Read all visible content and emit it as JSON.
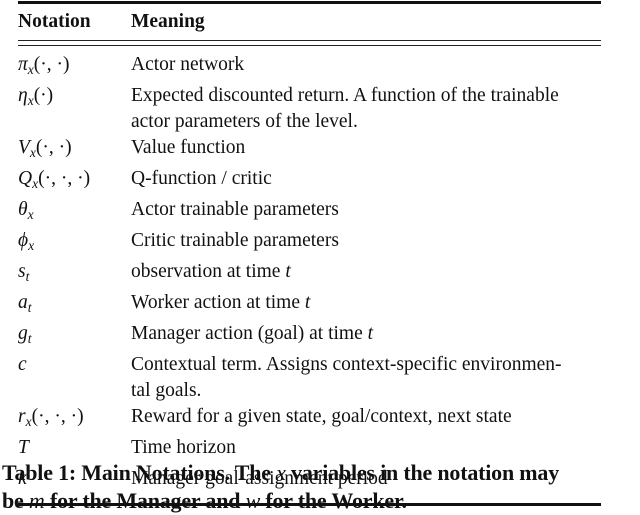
{
  "table": {
    "headers": {
      "notation": "Notation",
      "meaning": "Meaning"
    },
    "rows": [
      {
        "symbol": "π",
        "sub": "x",
        "args": "(·, ·)",
        "meaning": "Actor network"
      },
      {
        "symbol": "η",
        "sub": "x",
        "args": "(·)",
        "meaning": "Expected discounted return. A function of the trainable actor parameters of the level."
      },
      {
        "symbol": "V",
        "sub": "x",
        "args": "(·, ·)",
        "meaning": "Value function"
      },
      {
        "symbol": "Q",
        "sub": "x",
        "args": "(·, ·, ·)",
        "meaning": "Q-function / critic"
      },
      {
        "symbol": "θ",
        "sub": "x",
        "args": "",
        "meaning": "Actor trainable parameters"
      },
      {
        "symbol": "ϕ",
        "sub": "x",
        "args": "",
        "meaning": "Critic trainable parameters"
      },
      {
        "symbol": "s",
        "sub": "t",
        "args": "",
        "meaning": "observation at time",
        "meaning_var": "t"
      },
      {
        "symbol": "a",
        "sub": "t",
        "args": "",
        "meaning": "Worker action at time",
        "meaning_var": "t"
      },
      {
        "symbol": "g",
        "sub": "t",
        "args": "",
        "meaning": "Manager action (goal) at time",
        "meaning_var": "t"
      },
      {
        "symbol": "c",
        "sub": "",
        "args": "",
        "meaning": "Contextual term. Assigns context-specific environmen-",
        "meaning_line2": "tal goals."
      },
      {
        "symbol": "r",
        "sub": "x",
        "args": "(·, ·, ·)",
        "meaning": "Reward for a given state, goal/context, next state"
      },
      {
        "symbol": "T",
        "sub": "",
        "args": "",
        "meaning": "Time horizon"
      },
      {
        "symbol": "k",
        "sub": "",
        "args": "",
        "meaning": "Manager goal-assignment period"
      }
    ]
  },
  "caption": {
    "part1": "Table 1: Main Notations. The",
    "var_x": "x",
    "part2": "variables in the notation may",
    "part3": "be",
    "var_m": "m",
    "part4": "for the Manager and",
    "var_w": "w",
    "part5": "for the Worker."
  }
}
